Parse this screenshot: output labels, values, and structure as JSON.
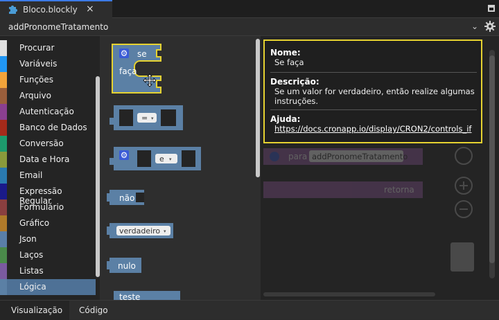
{
  "tab": {
    "title": "Bloco.blockly",
    "close": "×"
  },
  "header": {
    "function_name": "addPronomeTratamento",
    "chevron": "⌄"
  },
  "categories": [
    {
      "label": "Procurar",
      "color": "#e0e0e0"
    },
    {
      "label": "Variáveis",
      "color": "#2196f3"
    },
    {
      "label": "Funções",
      "color": "#f2a33a"
    },
    {
      "label": "Arquivo",
      "color": "#9a5e3b"
    },
    {
      "label": "Autenticação",
      "color": "#8a3f8f"
    },
    {
      "label": "Banco de Dados",
      "color": "#a52a1a"
    },
    {
      "label": "Conversão",
      "color": "#1d9a6c"
    },
    {
      "label": "Data e Hora",
      "color": "#8a9a3b"
    },
    {
      "label": "Email",
      "color": "#2a7ab0"
    },
    {
      "label": "Expressão Regular",
      "color": "#1a1a8a"
    },
    {
      "label": "Formulário",
      "color": "#8a3f3f"
    },
    {
      "label": "Gráfico",
      "color": "#b07a2a"
    },
    {
      "label": "Json",
      "color": "#5a7fa8"
    },
    {
      "label": "Laços",
      "color": "#4a8a4a"
    },
    {
      "label": "Listas",
      "color": "#7a5aa0"
    },
    {
      "label": "Lógica",
      "color": "#5b80a5"
    }
  ],
  "selected_category": "Lógica",
  "blocks": {
    "if_word": "se",
    "do_word": "faça",
    "compare_op": "=",
    "logic_op": "e",
    "not_word": "não",
    "true_word": "verdadeiro",
    "null_word": "nulo",
    "partial_word": "teste"
  },
  "tooltip": {
    "name_label": "Nome:",
    "name_value": "Se faça",
    "desc_label": "Descrição:",
    "desc_line1": "Se um valor for verdadeiro, então realize algumas",
    "desc_line2": "instruções.",
    "help_label": "Ajuda:",
    "help_link": "https://docs.cronapp.io/display/CRON2/controls_if"
  },
  "canvas": {
    "proc_to": "para",
    "proc_name": "addPronomeTratamento",
    "return_label": "retorna"
  },
  "bottom_tabs": [
    "Visualização",
    "Código"
  ],
  "colors": {
    "logic_block": "#5b80a5",
    "tooltip_border": "#e6d230",
    "procedure_block": "#995ba5"
  }
}
